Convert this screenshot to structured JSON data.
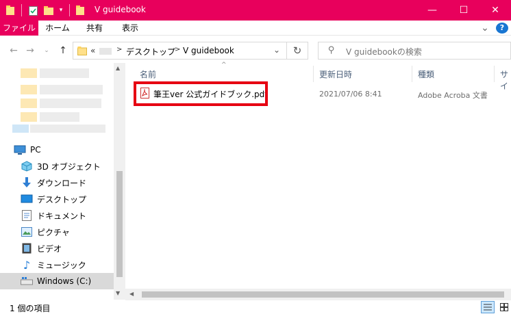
{
  "window": {
    "title": "V  guidebook",
    "minimize_glyph": "—",
    "maximize_glyph": "☐",
    "close_glyph": "✕"
  },
  "ribbon": {
    "tabs": [
      {
        "label": "ファイル"
      },
      {
        "label": "ホーム"
      },
      {
        "label": "共有"
      },
      {
        "label": "表示"
      }
    ],
    "chevron": "⌄",
    "help": "?"
  },
  "address": {
    "prefix": "«",
    "path": [
      {
        "label": "デスクトップ"
      },
      {
        "label": "V  guidebook"
      }
    ],
    "separator": ">"
  },
  "search": {
    "placeholder": "V  guidebookの検索"
  },
  "nav": {
    "items": [
      {
        "label": "PC",
        "icon": "pc-icon"
      },
      {
        "label": "3D オブジェクト",
        "icon": "3d-objects-icon"
      },
      {
        "label": "ダウンロード",
        "icon": "download-icon"
      },
      {
        "label": "デスクトップ",
        "icon": "desktop-icon"
      },
      {
        "label": "ドキュメント",
        "icon": "documents-icon"
      },
      {
        "label": "ピクチャ",
        "icon": "pictures-icon"
      },
      {
        "label": "ビデオ",
        "icon": "videos-icon"
      },
      {
        "label": "ミュージック",
        "icon": "music-icon"
      },
      {
        "label": "Windows (C:)",
        "icon": "drive-icon"
      }
    ],
    "selected": "Windows (C:)"
  },
  "columns": [
    {
      "label": "名前"
    },
    {
      "label": "更新日時"
    },
    {
      "label": "種類"
    },
    {
      "label": "サイ"
    }
  ],
  "files": [
    {
      "name": "筆王ver  公式ガイドブック.pdf",
      "modified": "2021/07/06 8:41",
      "type": "Adobe Acroba 文書",
      "icon": "pdf-icon"
    }
  ],
  "status": {
    "item_count": "1 個の項目"
  },
  "colors": {
    "accent": "#e8005c",
    "highlight_border": "#e60012",
    "selected_nav": "#d9d9d9"
  }
}
